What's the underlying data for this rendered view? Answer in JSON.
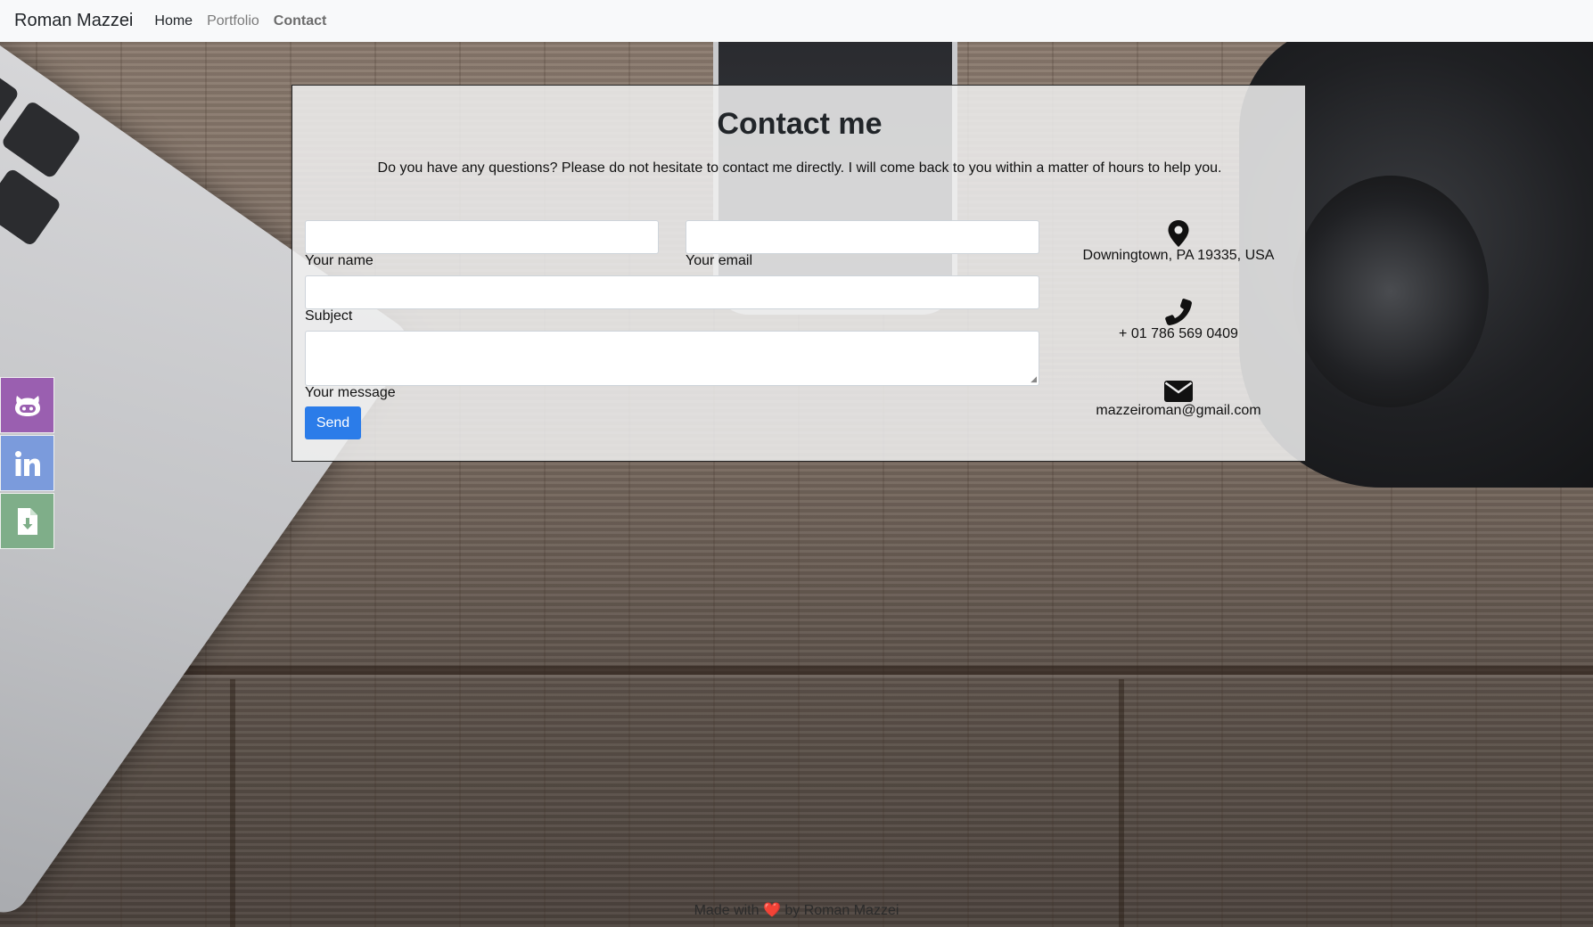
{
  "navbar": {
    "brand": "Roman Mazzei",
    "links": [
      {
        "label": "Home"
      },
      {
        "label": "Portfolio"
      },
      {
        "label": "Contact"
      }
    ]
  },
  "contact": {
    "title": "Contact me",
    "intro": "Do you have any questions? Please do not hesitate to contact me directly. I will come back to you within a matter of hours to help you.",
    "form": {
      "name_label": "Your name",
      "email_label": "Your email",
      "subject_label": "Subject",
      "message_label": "Your message",
      "send_label": "Send"
    },
    "info": {
      "address": "Downingtown, PA 19335, USA",
      "phone": "+ 01 786 569 0409",
      "email": "mazzeiroman@gmail.com"
    }
  },
  "social": {
    "items": [
      {
        "icon": "github-icon",
        "color": "#9a5fb0"
      },
      {
        "icon": "linkedin-icon",
        "color": "#7b9bdc"
      },
      {
        "icon": "download-file-icon",
        "color": "#7fae89"
      }
    ]
  },
  "footer": {
    "before": "Made with",
    "heart": "❤️",
    "after": "by Roman Mazzei"
  },
  "colors": {
    "accent": "#2b7ce9",
    "navbar_bg": "#f8f9fa"
  }
}
